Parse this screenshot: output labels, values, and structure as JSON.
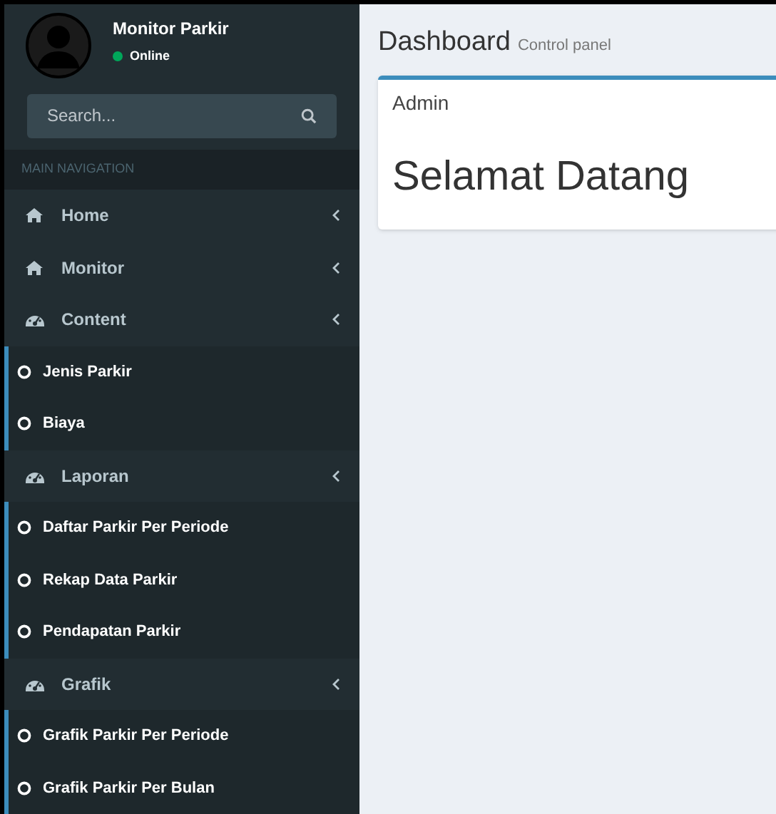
{
  "user_panel": {
    "name": "Monitor Parkir",
    "status": "Online"
  },
  "search": {
    "placeholder": "Search..."
  },
  "nav_header": "MAIN NAVIGATION",
  "menu": [
    {
      "label": "Home",
      "kind": "link"
    },
    {
      "label": "Monitor",
      "kind": "link"
    },
    {
      "label": "Content",
      "kind": "tree",
      "children": [
        {
          "label": "Jenis Parkir"
        },
        {
          "label": "Biaya"
        }
      ]
    },
    {
      "label": "Laporan",
      "kind": "tree",
      "children": [
        {
          "label": "Daftar Parkir Per Periode"
        },
        {
          "label": "Rekap Data Parkir"
        },
        {
          "label": "Pendapatan Parkir"
        }
      ]
    },
    {
      "label": "Grafik",
      "kind": "tree",
      "children": [
        {
          "label": "Grafik Parkir Per Periode"
        },
        {
          "label": "Grafik Parkir Per Bulan"
        }
      ]
    }
  ],
  "page_header": {
    "title": "Dashboard",
    "subtitle": "Control panel"
  },
  "box": {
    "title": "Admin",
    "message": "Selamat Datang"
  }
}
